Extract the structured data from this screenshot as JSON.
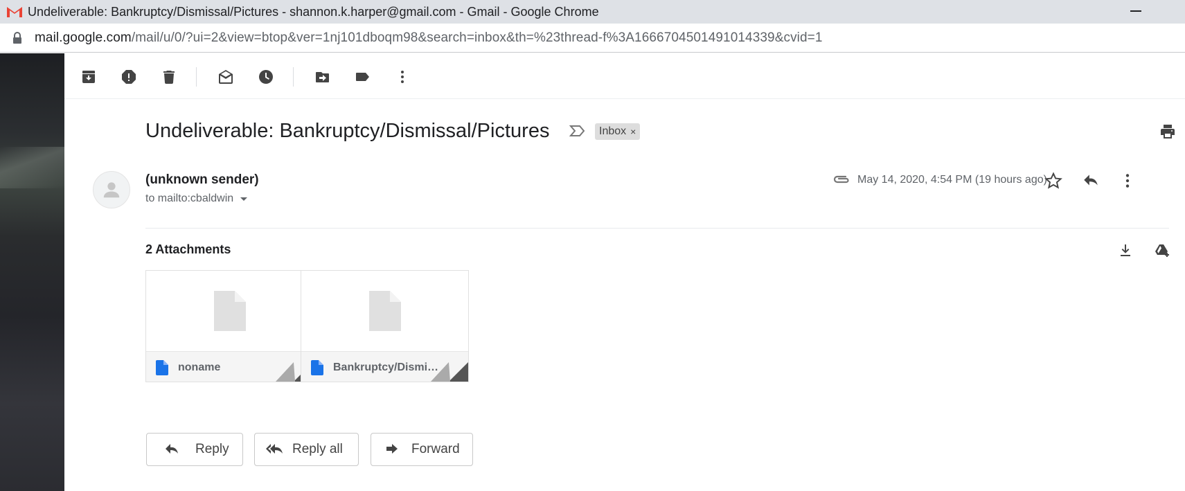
{
  "window": {
    "title": "Undeliverable: Bankruptcy/Dismissal/Pictures - shannon.k.harper@gmail.com - Gmail - Google Chrome"
  },
  "address": {
    "host": "mail.google.com",
    "path": "/mail/u/0/?ui=2&view=btop&ver=1nj101dboqm98&search=inbox&th=%23thread-f%3A1666704501491014339&cvid=1"
  },
  "toolbar": {
    "icons": [
      "archive-icon",
      "report-spam-icon",
      "delete-icon",
      "mark-unread-icon",
      "snooze-icon",
      "move-to-icon",
      "label-icon",
      "more-vert-icon"
    ]
  },
  "email": {
    "subject": "Undeliverable: Bankruptcy/Dismissal/Pictures",
    "label": "Inbox",
    "label_close": "×",
    "sender": "(unknown sender)",
    "to": "to mailto:cbaldwin",
    "date": "May 14, 2020, 4:54 PM (19 hours ago)"
  },
  "attachments": {
    "title": "2 Attachments",
    "items": [
      {
        "name": "noname"
      },
      {
        "name": "Bankruptcy/Dismissal/Pictures"
      }
    ]
  },
  "actions": {
    "reply": "Reply",
    "reply_all": "Reply all",
    "forward": "Forward"
  },
  "colors": {
    "gmail_red": "#ea4335",
    "file_blue": "#1a73e8",
    "icon_gray": "#444444"
  }
}
